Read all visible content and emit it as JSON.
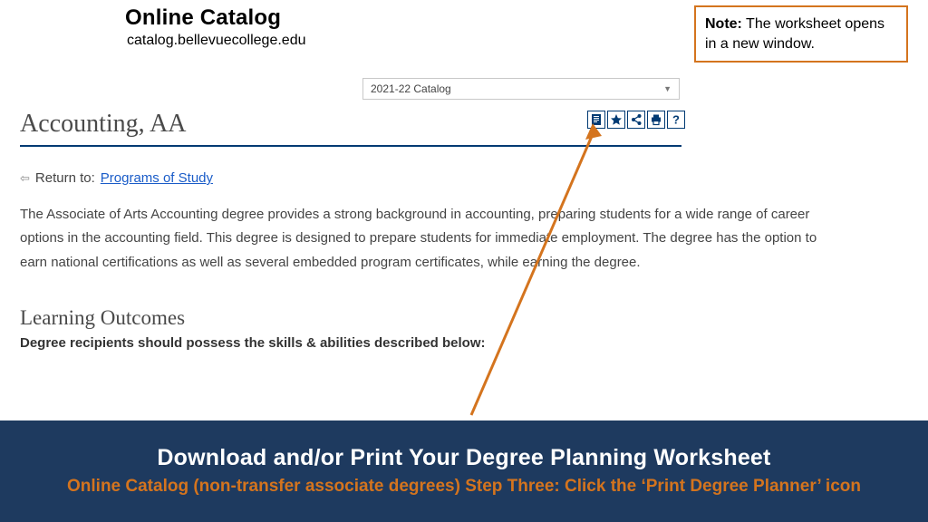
{
  "header": {
    "title": "Online Catalog",
    "subtitle": "catalog.bellevuecollege.edu"
  },
  "note": {
    "label": "Note:",
    "text": " The worksheet opens in a new window."
  },
  "select": {
    "value": "2021-22 Catalog"
  },
  "page": {
    "title": "Accounting, AA",
    "return_prefix": "Return to:",
    "return_link": "Programs of Study",
    "description": "The Associate of Arts Accounting degree provides a strong background in accounting, preparing students for a wide range of career options in the accounting field. This degree is designed to prepare students for immediate employment. The degree has the option to earn national certifications as well as several embedded program certificates, while earning the degree.",
    "subhead": "Learning Outcomes",
    "sub_text": "Degree recipients should possess the skills & abilities described below:"
  },
  "icons": {
    "planner": "print-degree-planner",
    "favorite": "add-favorites",
    "share": "share",
    "print": "print",
    "help": "help"
  },
  "banner": {
    "title": "Download and/or Print Your Degree Planning Worksheet",
    "subtitle": "Online Catalog (non-transfer associate degrees) Step Three: Click the ‘Print Degree Planner’ icon"
  },
  "colors": {
    "accent_orange": "#d4741e",
    "navy": "#1e3a5f",
    "deep_blue": "#003a73",
    "link_blue": "#1a5cc8"
  }
}
